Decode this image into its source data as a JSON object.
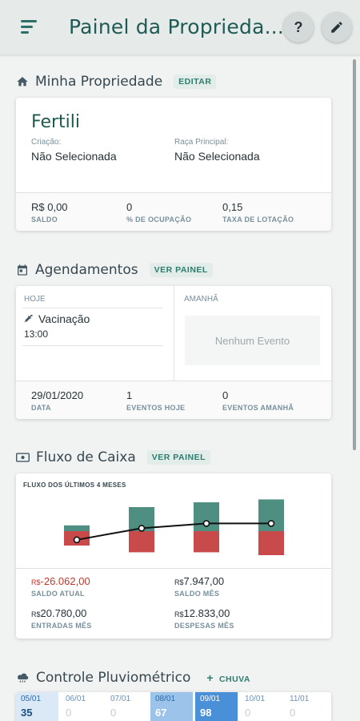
{
  "appbar": {
    "title": "Painel da Proprieda...",
    "help_label": "?"
  },
  "property": {
    "section_title": "Minha Propriedade",
    "action": "EDITAR",
    "name": "Fertili",
    "creation_label": "Criação:",
    "creation_value": "Não Selecionada",
    "breed_label": "Raça Principal:",
    "breed_value": "Não Selecionada",
    "stats": [
      {
        "value": "R$ 0,00",
        "label": "SALDO"
      },
      {
        "value": "0",
        "label": "% DE OCUPAÇÃO"
      },
      {
        "value": "0,15",
        "label": "TAXA DE LOTAÇÃO"
      }
    ]
  },
  "schedule": {
    "section_title": "Agendamentos",
    "action": "VER PAINEL",
    "today_label": "HOJE",
    "tomorrow_label": "AMANHÃ",
    "today_event": {
      "name": "Vacinação",
      "time": "13:00"
    },
    "no_event": "Nenhum Evento",
    "stats": [
      {
        "value": "29/01/2020",
        "label": "DATA"
      },
      {
        "value": "1",
        "label": "EVENTOS HOJE"
      },
      {
        "value": "0",
        "label": "EVENTOS AMANHÃ"
      }
    ]
  },
  "cashflow": {
    "section_title": "Fluxo de Caixa",
    "action": "VER PAINEL",
    "chart_title": "FLUXO DOS ÚLTIMOS 4 MESES",
    "stats": [
      {
        "currency": "R$",
        "value": "-26.062,00",
        "label": "SALDO ATUAL",
        "negative": true
      },
      {
        "currency": "R$",
        "value": "7.947,00",
        "label": "SALDO MÊS"
      },
      {
        "currency": "R$",
        "value": "20.780,00",
        "label": "ENTRADAS MÊS"
      },
      {
        "currency": "R$",
        "value": "12.833,00",
        "label": "DESPESAS MÊS"
      }
    ]
  },
  "rain": {
    "section_title": "Controle Pluviométrico",
    "action": "CHUVA",
    "days": [
      {
        "date": "05/01",
        "value": "35"
      },
      {
        "date": "06/01",
        "value": "0"
      },
      {
        "date": "07/01",
        "value": "0"
      },
      {
        "date": "08/01",
        "value": "67"
      },
      {
        "date": "09/01",
        "value": "98"
      },
      {
        "date": "10/01",
        "value": "0"
      },
      {
        "date": "11/01",
        "value": "0"
      }
    ]
  },
  "colors": {
    "accent": "#2e7d6f",
    "income": "#4f8f82",
    "expense": "#c94a4a",
    "negative": "#c0392b"
  },
  "chart_data": {
    "type": "bar",
    "title": "FLUXO DOS ÚLTIMOS 4 MESES",
    "categories": [
      "",
      "",
      "",
      ""
    ],
    "series": [
      {
        "values": [
          6000,
          25000,
          30000,
          33000
        ]
      },
      {
        "values": [
          -15000,
          -22000,
          -22000,
          -25000
        ]
      },
      {
        "type": "line",
        "values": [
          -9000,
          3000,
          8000,
          8000
        ]
      }
    ],
    "ylim": [
      -35000,
      40000
    ]
  }
}
